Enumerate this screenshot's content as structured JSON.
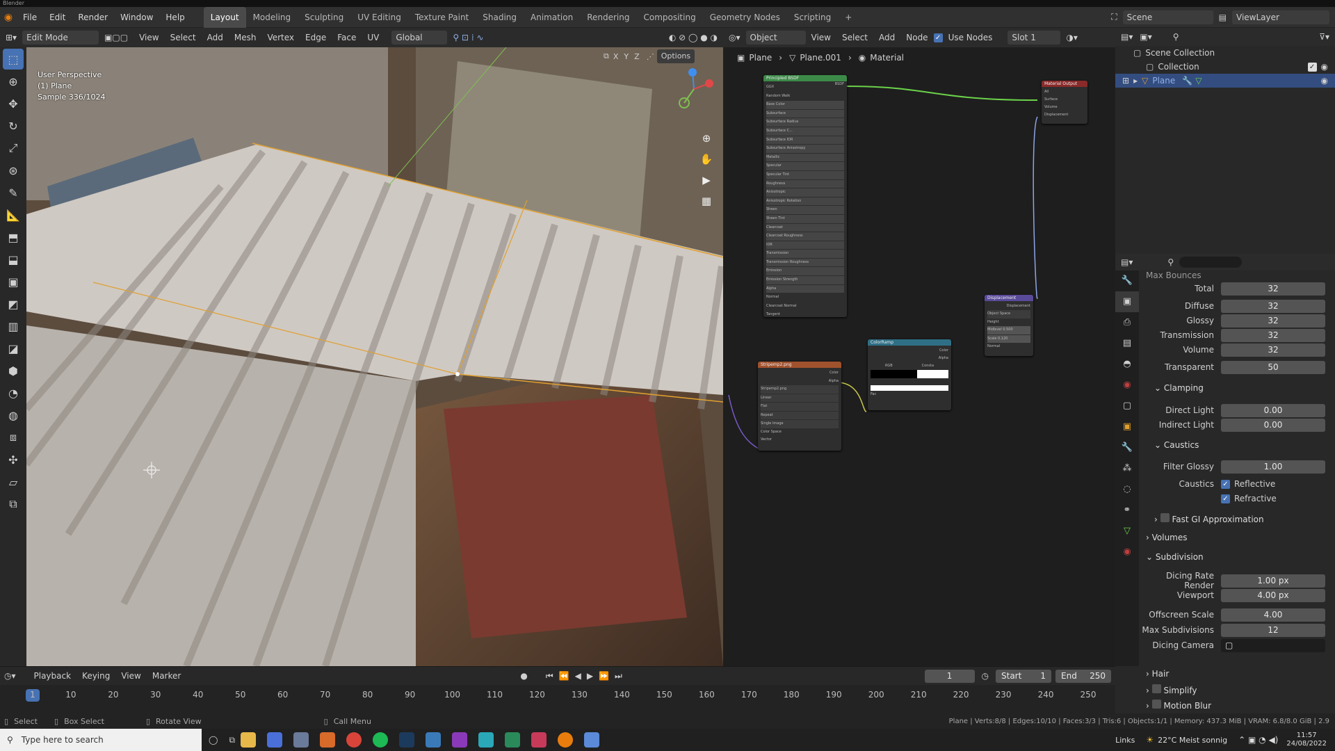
{
  "window": {
    "title": "Blender"
  },
  "topbar": {
    "menus": [
      "File",
      "Edit",
      "Render",
      "Window",
      "Help"
    ],
    "workspaces": [
      "Layout",
      "Modeling",
      "Sculpting",
      "UV Editing",
      "Texture Paint",
      "Shading",
      "Animation",
      "Rendering",
      "Compositing",
      "Geometry Nodes",
      "Scripting"
    ],
    "active_workspace": "Layout",
    "add_tab": "+",
    "scene": "Scene",
    "view_layer": "ViewLayer"
  },
  "viewport_header": {
    "mode": "Edit Mode",
    "menus": [
      "View",
      "Select",
      "Add",
      "Mesh",
      "Vertex",
      "Edge",
      "Face",
      "UV"
    ],
    "transform_orientation": "Global",
    "axes": [
      "X",
      "Y",
      "Z"
    ],
    "options": "Options"
  },
  "viewport": {
    "info_lines": [
      "User Perspective",
      "(1) Plane",
      "Sample 336/1024"
    ]
  },
  "node_header": {
    "object_type": "Object",
    "menus": [
      "View",
      "Select",
      "Add",
      "Node"
    ],
    "use_nodes": "Use Nodes",
    "slot": "Slot 1",
    "breadcrumb": [
      "Plane",
      "Plane.001",
      "Material"
    ]
  },
  "nodes": {
    "principled": {
      "title": "Principled BSDF",
      "out": "BSDF",
      "rows": [
        "GGX",
        "Random Walk",
        "Base Color",
        "Subsurface",
        "Subsurface Radius",
        "Subsurface C...",
        "Subsurface IOR",
        "Subsurface Anisotropy",
        "Metallic",
        "Specular",
        "Specular Tint",
        "Roughness",
        "Anisotropic",
        "Anisotropic Rotation",
        "Sheen",
        "Sheen Tint",
        "Clearcoat",
        "Clearcoat Roughness",
        "IOR",
        "Transmission",
        "Transmission Roughness",
        "Emission",
        "Emission Strength",
        "Alpha",
        "Normal",
        "Clearcoat Normal",
        "Tangent"
      ]
    },
    "output": {
      "title": "Material Output",
      "rows": [
        "All",
        "Surface",
        "Volume",
        "Displacement"
      ]
    },
    "image": {
      "title": "Stripemp2.png",
      "rows": [
        "Color",
        "Alpha",
        "Stripemp2.png",
        "Linear",
        "Flat",
        "Repeat",
        "Single Image",
        "Color Space",
        "Vector"
      ]
    },
    "colorramp": {
      "title": "ColorRamp",
      "rows": [
        "Color",
        "Alpha",
        "RGB",
        "Consta",
        "Fac"
      ]
    },
    "displacement": {
      "title": "Displacement",
      "rows": [
        "Displacement",
        "Object Space",
        "Height",
        "Midlevel 0.500",
        "Scale 0.120",
        "Normal"
      ]
    }
  },
  "outliner": {
    "items": [
      {
        "label": "Scene Collection"
      },
      {
        "label": "Collection"
      },
      {
        "label": "Plane"
      }
    ]
  },
  "properties": {
    "section_top": "Max Bounces",
    "rows": [
      {
        "label": "Total",
        "value": "32"
      },
      {
        "label": "Diffuse",
        "value": "32"
      },
      {
        "label": "Glossy",
        "value": "32"
      },
      {
        "label": "Transmission",
        "value": "32"
      },
      {
        "label": "Volume",
        "value": "32"
      },
      {
        "label": "Transparent",
        "value": "50"
      }
    ],
    "clamping": {
      "title": "Clamping",
      "direct_label": "Direct Light",
      "direct": "0.00",
      "indirect_label": "Indirect Light",
      "indirect": "0.00"
    },
    "caustics": {
      "title": "Caustics",
      "filter_label": "Filter Glossy",
      "filter": "1.00",
      "caustics_label": "Caustics",
      "reflective": "Reflective",
      "refractive": "Refractive"
    },
    "fast_gi": "Fast GI Approximation",
    "volumes": "Volumes",
    "subdivision": {
      "title": "Subdivision",
      "render_label": "Dicing Rate Render",
      "render": "1.00 px",
      "viewport_label": "Viewport",
      "viewport": "4.00 px",
      "offscreen_label": "Offscreen Scale",
      "offscreen": "4.00",
      "maxsub_label": "Max Subdivisions",
      "maxsub": "12",
      "camera_label": "Dicing Camera"
    },
    "hair": "Hair",
    "simplify": "Simplify",
    "motion_blur": "Motion Blur"
  },
  "timeline": {
    "menus": [
      "Playback",
      "Keying",
      "View",
      "Marker"
    ],
    "current_frame": "1",
    "start_label": "Start",
    "start": "1",
    "end_label": "End",
    "end": "250",
    "ticks": [
      "1",
      "10",
      "20",
      "30",
      "40",
      "50",
      "60",
      "70",
      "80",
      "90",
      "100",
      "110",
      "120",
      "130",
      "140",
      "150",
      "160",
      "170",
      "180",
      "190",
      "200",
      "210",
      "220",
      "230",
      "240",
      "250"
    ]
  },
  "statusbar": {
    "select": "Select",
    "box_select": "Box Select",
    "rotate_view": "Rotate View",
    "call_menu": "Call Menu",
    "stats": "Plane | Verts:8/8 | Edges:10/10 | Faces:3/3 | Tris:6 | Objects:1/1 | Memory: 437.3 MiB | VRAM: 6.8/8.0 GiB | 2.9"
  },
  "taskbar": {
    "search_placeholder": "Type here to search",
    "weather": "22°C  Meist sonnig",
    "links": "Links",
    "time": "11:57",
    "date": "24/08/2022"
  },
  "colors": {
    "accent": "#4772b3",
    "edge": "#e0a030"
  }
}
